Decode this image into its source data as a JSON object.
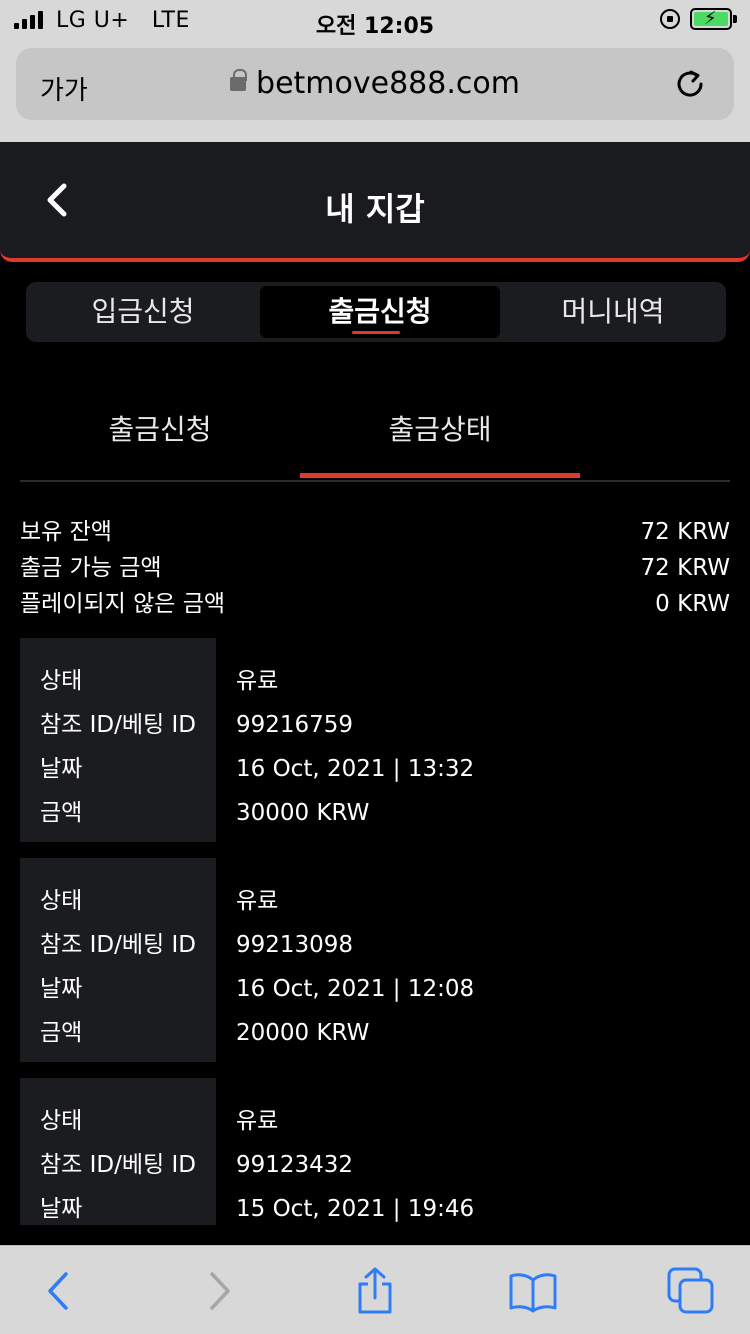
{
  "status_bar": {
    "carrier": "LG U+",
    "network": "LTE",
    "time": "오전 12:05"
  },
  "browser": {
    "text_size": "가가",
    "url": "betmove888.com"
  },
  "header": {
    "title": "내 지갑"
  },
  "main_tabs": [
    {
      "label": "입금신청",
      "active": false
    },
    {
      "label": "출금신청",
      "active": true
    },
    {
      "label": "머니내역",
      "active": false
    }
  ],
  "sub_tabs": [
    {
      "label": "출금신청",
      "active": false
    },
    {
      "label": "출금상태",
      "active": true
    }
  ],
  "summary": [
    {
      "label": "보유 잔액",
      "value": "72 KRW"
    },
    {
      "label": "출금 가능 금액",
      "value": "72 KRW"
    },
    {
      "label": "플레이되지 않은 금액",
      "value": "0 KRW"
    }
  ],
  "field_labels": {
    "status": "상태",
    "ref": "참조 ID/베팅 ID",
    "date": "날짜",
    "amount": "금액"
  },
  "transactions": [
    {
      "status": "유료",
      "ref": "99216759",
      "date": "16 Oct, 2021 | 13:32",
      "amount": "30000 KRW"
    },
    {
      "status": "유료",
      "ref": "99213098",
      "date": "16 Oct, 2021 | 12:08",
      "amount": "20000 KRW"
    },
    {
      "status": "유료",
      "ref": "99123432",
      "date": "15 Oct, 2021 | 19:46",
      "amount": ""
    }
  ],
  "colors": {
    "accent": "#e2372c",
    "panel": "#1b1c20",
    "ios_blue": "#2f7cf6"
  },
  "icons": {
    "toolbar": [
      "chevron-left-icon",
      "chevron-right-icon",
      "share-icon",
      "bookmarks-icon",
      "tabs-icon"
    ]
  }
}
